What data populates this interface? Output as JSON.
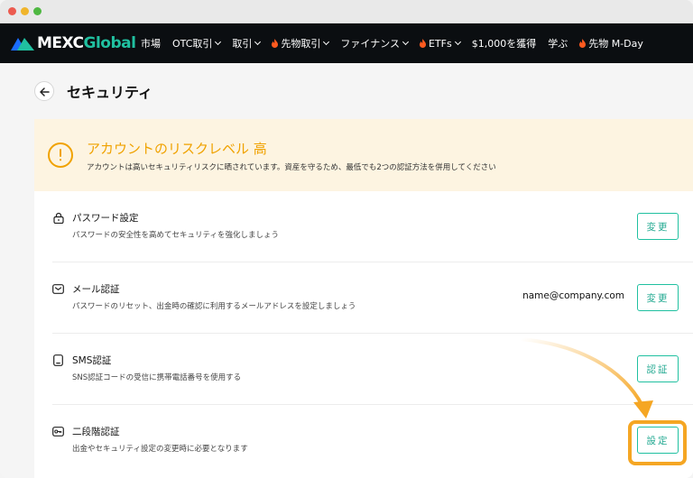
{
  "window": {
    "controls": [
      "close",
      "minimize",
      "maximize"
    ]
  },
  "navbar": {
    "logo_main": "MEXC",
    "logo_accent": "Global",
    "items": [
      {
        "label": "市場",
        "has_chevron": false,
        "has_fire": false
      },
      {
        "label": "OTC取引",
        "has_chevron": true,
        "has_fire": false
      },
      {
        "label": "取引",
        "has_chevron": true,
        "has_fire": false
      },
      {
        "label": "先物取引",
        "has_chevron": true,
        "has_fire": true
      },
      {
        "label": "ファイナンス",
        "has_chevron": true,
        "has_fire": false
      },
      {
        "label": "ETFs",
        "has_chevron": true,
        "has_fire": true
      },
      {
        "label": "$1,000を獲得",
        "has_chevron": false,
        "has_fire": false
      },
      {
        "label": "学ぶ",
        "has_chevron": false,
        "has_fire": false
      },
      {
        "label": "先物 M-Day",
        "has_chevron": false,
        "has_fire": true
      }
    ]
  },
  "page": {
    "title": "セキュリティ"
  },
  "warning": {
    "title": "アカウントのリスクレベル 高",
    "description": "アカウントは高いセキュリティリスクに晒されています。資産を守るため、最低でも2つの認証方法を併用してください",
    "icon": "exclamation-circle-icon"
  },
  "security_items": [
    {
      "icon": "lock-icon",
      "title": "パスワード設定",
      "description": "パスワードの安全性を高めてセキュリティを強化しましょう",
      "value": "",
      "action": "変更"
    },
    {
      "icon": "mail-icon",
      "title": "メール認証",
      "description": "パスワードのリセット、出金時の確認に利用するメールアドレスを設定しましょう",
      "value": "name@company.com",
      "action": "変更"
    },
    {
      "icon": "phone-icon",
      "title": "SMS認証",
      "description": "SNS認証コードの受信に携帯電話番号を使用する",
      "value": "",
      "action": "認証"
    },
    {
      "icon": "key-icon",
      "title": "二段階認証",
      "description": "出金やセキュリティ設定の変更時に必要となります",
      "value": "",
      "action": "設定"
    }
  ],
  "colors": {
    "accent": "#20c0a0",
    "warning": "#f0a200",
    "highlight": "#f5a623",
    "navbar_bg": "#0b0e11"
  }
}
